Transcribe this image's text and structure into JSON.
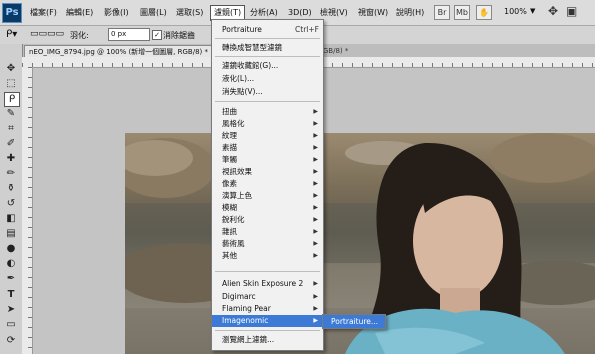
{
  "menubar": {
    "logo": "Ps",
    "items": [
      "檔案(F)",
      "編輯(E)",
      "影像(I)",
      "圖層(L)",
      "選取(S)",
      "濾鏡(T)",
      "分析(A)",
      "3D(D)",
      "檢視(V)",
      "視窗(W)",
      "說明(H)"
    ],
    "zoom": "100%",
    "toolbar_icons": [
      "Br",
      "Mb"
    ]
  },
  "options": {
    "feather_label": "羽化:",
    "feather_value": "0 px",
    "antialias_checked": "✓",
    "antialias_label": "消除鋸齒"
  },
  "tabs": {
    "active": "nEO_IMG_8794.jpg @ 100% (新增一個圖層, RGB/8) *",
    "second": "RGB/8) *"
  },
  "filter_menu": {
    "last_filter": "Portraiture",
    "last_filter_shortcut": "Ctrl+F",
    "smart_filters": "轉換成智慧型濾鏡",
    "gallery": "濾鏡收藏館(G)...",
    "liquify": "液化(L)...",
    "vanishing_point": "消失點(V)...",
    "categories": [
      "扭曲",
      "風格化",
      "紋理",
      "素描",
      "筆觸",
      "視訊效果",
      "像素",
      "演算上色",
      "模糊",
      "銳利化",
      "雜訊",
      "藝術風",
      "其他"
    ],
    "plugins": [
      "Alien Skin Exposure 2",
      "Digimarc",
      "Flaming Pear",
      "Imagenomic"
    ],
    "browse_online": "瀏覽網上濾鏡..."
  },
  "submenu": {
    "item": "Portraiture..."
  },
  "colors": {
    "highlight": "#3d7ad6",
    "menu_bg": "#f1f1f1"
  }
}
